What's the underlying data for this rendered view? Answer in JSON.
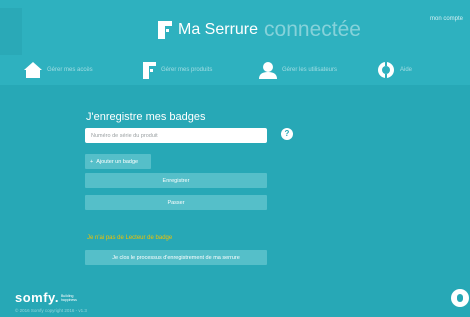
{
  "header": {
    "brand_title": "Ma Serrure",
    "brand_subtitle": "connectée",
    "account_link": "mon compte"
  },
  "nav": {
    "items": [
      {
        "label": "Gérer mes accès",
        "icon": "home-icon"
      },
      {
        "label": "Gérer mes produits",
        "icon": "lock-icon"
      },
      {
        "label": "Gérer les utilisateurs",
        "icon": "user-icon"
      },
      {
        "label": "Aide",
        "icon": "help-lifebuoy-icon"
      }
    ]
  },
  "form": {
    "title": "J'enregistre mes badges",
    "serial_placeholder": "Numéro de série du produit",
    "help_glyph": "?",
    "add_badge_label": "Ajouter un badge",
    "add_badge_glyph": "+",
    "register_label": "Enregistrer",
    "skip_label": "Passer",
    "no_reader_text": "Je n'ai pas de Lecteur de badge",
    "close_process_label": "Je clos le processus d'enregistrement de ma serrure"
  },
  "footer": {
    "logo_word": "somfy.",
    "logo_tagline_1": "Building",
    "logo_tagline_2": "happiness",
    "copyright": "© 2016 Somfy copyright 2016 - v1.3"
  },
  "colors": {
    "background": "#27a8b6",
    "header": "#2eb1bf",
    "button": "#55bfc9",
    "accent_yellow": "#f2c200"
  }
}
